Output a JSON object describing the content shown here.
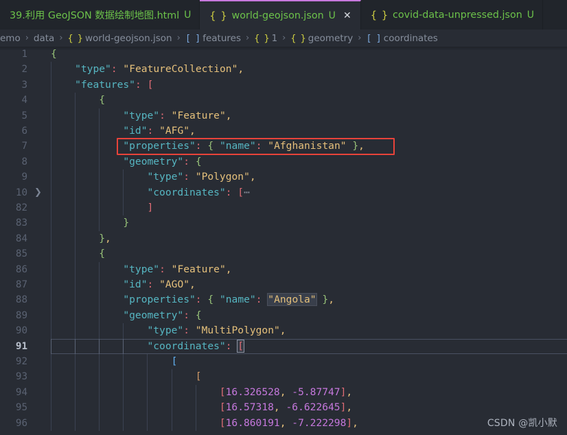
{
  "window": {
    "app": "Visual Studio Code",
    "theme_bg": "#282c34",
    "tabbar_bg": "#21252b",
    "active_tab_accent": "#c678dd",
    "annotation_color": "#e8433a"
  },
  "tabbar": {
    "tabs": [
      {
        "label": "39.利用 GeoJSON 数据绘制地图.html",
        "icon": "html-file-icon",
        "dirty_badge": "U",
        "active": false,
        "has_close": false
      },
      {
        "label": "world-geojson.json",
        "icon": "json-braces-icon",
        "dirty_badge": "U",
        "active": true,
        "has_close": true,
        "close_label": "✕"
      },
      {
        "label": "covid-data-unpressed.json",
        "icon": "json-braces-icon",
        "dirty_badge": "U",
        "active": false,
        "has_close": false
      }
    ],
    "json_icon_glyph": "{ }"
  },
  "breadcrumbs": {
    "separator": "›",
    "items": [
      {
        "label": "emo",
        "icon": ""
      },
      {
        "label": "data",
        "icon": ""
      },
      {
        "label": "world-geojson.json",
        "icon": "{ }",
        "icon_kind": "obj"
      },
      {
        "label": "features",
        "icon": "[ ]",
        "icon_kind": "arr"
      },
      {
        "label": "1",
        "icon": "{ }",
        "icon_kind": "obj"
      },
      {
        "label": "geometry",
        "icon": "{ }",
        "icon_kind": "obj"
      },
      {
        "label": "coordinates",
        "icon": "[ ]",
        "icon_kind": "arr"
      }
    ]
  },
  "editor": {
    "language": "json",
    "file": "world-geojson.json",
    "cursor_line": 91,
    "folded_lines": [
      10
    ],
    "annotation_rect_target_line": 7,
    "lines": [
      {
        "n": 1,
        "indent": 0,
        "text": "{"
      },
      {
        "n": 2,
        "indent": 1,
        "text": "\"type\": \"FeatureCollection\","
      },
      {
        "n": 3,
        "indent": 1,
        "text": "\"features\": ["
      },
      {
        "n": 4,
        "indent": 2,
        "text": "{"
      },
      {
        "n": 5,
        "indent": 3,
        "text": "\"type\": \"Feature\","
      },
      {
        "n": 6,
        "indent": 3,
        "text": "\"id\": \"AFG\","
      },
      {
        "n": 7,
        "indent": 3,
        "text": "\"properties\": { \"name\": \"Afghanistan\" },"
      },
      {
        "n": 8,
        "indent": 3,
        "text": "\"geometry\": {"
      },
      {
        "n": 9,
        "indent": 4,
        "text": "\"type\": \"Polygon\","
      },
      {
        "n": 10,
        "indent": 4,
        "text": "\"coordinates\": [⋯",
        "folded": true
      },
      {
        "n": 82,
        "indent": 4,
        "text": "]"
      },
      {
        "n": 83,
        "indent": 3,
        "text": "}"
      },
      {
        "n": 84,
        "indent": 2,
        "text": "},"
      },
      {
        "n": 85,
        "indent": 2,
        "text": "{"
      },
      {
        "n": 86,
        "indent": 3,
        "text": "\"type\": \"Feature\","
      },
      {
        "n": 87,
        "indent": 3,
        "text": "\"id\": \"AGO\","
      },
      {
        "n": 88,
        "indent": 3,
        "text": "\"properties\": { \"name\": \"Angola\" },"
      },
      {
        "n": 89,
        "indent": 3,
        "text": "\"geometry\": {"
      },
      {
        "n": 90,
        "indent": 4,
        "text": "\"type\": \"MultiPolygon\","
      },
      {
        "n": 91,
        "indent": 4,
        "text": "\"coordinates\": [",
        "current": true
      },
      {
        "n": 92,
        "indent": 5,
        "text": "["
      },
      {
        "n": 93,
        "indent": 6,
        "text": "["
      },
      {
        "n": 94,
        "indent": 7,
        "text": "[16.326528, -5.87747],"
      },
      {
        "n": 95,
        "indent": 7,
        "text": "[16.57318, -6.622645],"
      },
      {
        "n": 96,
        "indent": 7,
        "text": "[16.860191, -7.222298],"
      }
    ],
    "word_highlight": "Angola"
  },
  "watermark": {
    "text": "CSDN @凯小默"
  }
}
